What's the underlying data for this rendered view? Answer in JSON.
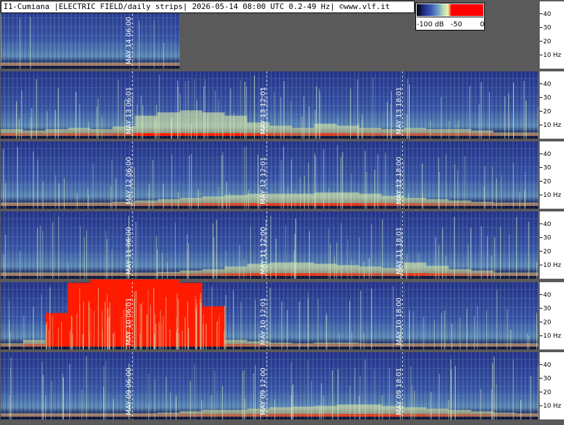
{
  "header": {
    "title": "I1-Cumiana |ELECTRIC FIELD/daily strips| 2026-05-14 08:00 UTC 0.2-49 Hz| ©www.vlf.it"
  },
  "colorbar": {
    "labels": [
      "-100 dB",
      "-50",
      "0"
    ],
    "colors": {
      "low": "#000000",
      "mid_low": "#1e2a80",
      "mid": "#3b5ab8",
      "mid_high": "#b5dcb0",
      "high": "#ff0000"
    }
  },
  "colors": {
    "background": "#5a5a5a",
    "axis_panel": "#ffffff",
    "spectrogram_base": "#2b3e92",
    "event_red": "#ff0000",
    "marker_lines": "#ffffff"
  },
  "chart_data": {
    "type": "heatmap",
    "x_unit": "UTC time of day",
    "y_unit": "Hz",
    "ylim": [
      0,
      49
    ],
    "y_ticks": [
      10,
      20,
      30,
      40
    ],
    "y_tick_labels": [
      "10 Hz",
      "20",
      "30",
      "40"
    ],
    "colorbar_range_db": [
      -100,
      0
    ],
    "strips": [
      {
        "date": "MAY 14",
        "markers": [
          "06:00"
        ],
        "recorded_until_fraction": 0.333,
        "activity": [
          0.05,
          0.05,
          0.06,
          0.08,
          0.12,
          0.15
        ]
      },
      {
        "date": "MAY 13",
        "markers": [
          "06:01",
          "12:01",
          "18:01"
        ],
        "recorded_until_fraction": 1.0,
        "activity": [
          0.1,
          0.08,
          0.1,
          0.12,
          0.1,
          0.14,
          0.3,
          0.35,
          0.38,
          0.35,
          0.3,
          0.2,
          0.15,
          0.12,
          0.18,
          0.15,
          0.12,
          0.1,
          0.12,
          0.1,
          0.1,
          0.08,
          0.05,
          0.05
        ]
      },
      {
        "date": "MAY 12",
        "markers": [
          "06:00",
          "12:01",
          "18:00"
        ],
        "recorded_until_fraction": 1.0,
        "activity": [
          0.05,
          0.05,
          0.05,
          0.05,
          0.05,
          0.06,
          0.08,
          0.1,
          0.12,
          0.14,
          0.16,
          0.18,
          0.18,
          0.18,
          0.2,
          0.2,
          0.18,
          0.15,
          0.12,
          0.1,
          0.08,
          0.06,
          0.05,
          0.05
        ]
      },
      {
        "date": "MAY 11",
        "markers": [
          "06:00",
          "12:00",
          "18:01"
        ],
        "recorded_until_fraction": 1.0,
        "activity": [
          0.05,
          0.05,
          0.05,
          0.05,
          0.05,
          0.05,
          0.05,
          0.06,
          0.08,
          0.1,
          0.14,
          0.18,
          0.2,
          0.2,
          0.18,
          0.16,
          0.14,
          0.12,
          0.2,
          0.15,
          0.1,
          0.08,
          0.05,
          0.05
        ]
      },
      {
        "date": "MAY 10",
        "markers": [
          "06:01",
          "12:01",
          "18:00"
        ],
        "recorded_until_fraction": 1.0,
        "activity": [
          0.05,
          0.1,
          0.5,
          0.95,
          1.0,
          1.0,
          1.0,
          1.0,
          0.95,
          0.6,
          0.1,
          0.08,
          0.06,
          0.05,
          0.06,
          0.06,
          0.05,
          0.05,
          0.05,
          0.05,
          0.05,
          0.05,
          0.05,
          0.05
        ]
      },
      {
        "date": "MAY 09",
        "markers": [
          "06:00",
          "12:00",
          "18:01"
        ],
        "recorded_until_fraction": 1.0,
        "activity": [
          0.05,
          0.05,
          0.05,
          0.05,
          0.05,
          0.05,
          0.05,
          0.06,
          0.08,
          0.1,
          0.1,
          0.12,
          0.14,
          0.15,
          0.16,
          0.18,
          0.18,
          0.16,
          0.14,
          0.12,
          0.1,
          0.08,
          0.06,
          0.05
        ]
      }
    ]
  }
}
